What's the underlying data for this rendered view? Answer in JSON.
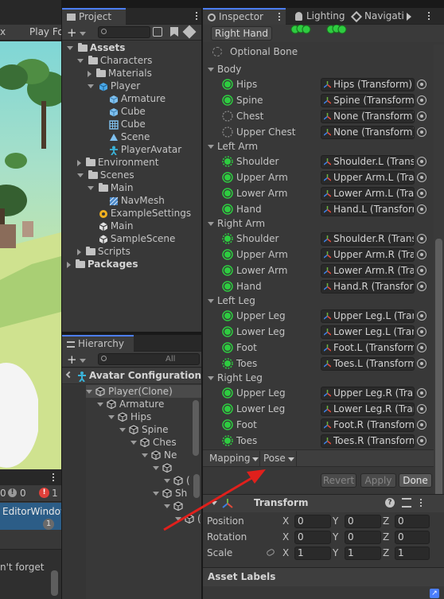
{
  "scene_view": {
    "tabs": [
      "x",
      "Play Fo"
    ],
    "console_counts": [
      "0",
      "0",
      "1"
    ],
    "editor_window_label": "EditorWindow",
    "editor_window_badge": "1",
    "console_message": "n't forget"
  },
  "project": {
    "tab_label": "Project",
    "add_label": "+",
    "tree": [
      {
        "label": "Assets",
        "bold": true,
        "icon": "folder-icon",
        "expanded": true
      },
      {
        "label": "Characters",
        "icon": "folder-icon",
        "expanded": true
      },
      {
        "label": "Materials",
        "icon": "folder-icon",
        "expanded": false
      },
      {
        "label": "Player",
        "icon": "prefab-icon",
        "expanded": true
      },
      {
        "label": "Armature",
        "icon": "mesh-icon"
      },
      {
        "label": "Cube",
        "icon": "mesh-icon"
      },
      {
        "label": "Cube",
        "icon": "grid-icon"
      },
      {
        "label": "Scene",
        "icon": "scene-icon"
      },
      {
        "label": "PlayerAvatar",
        "icon": "avatar-icon"
      },
      {
        "label": "Environment",
        "icon": "folder-icon",
        "expanded": false
      },
      {
        "label": "Scenes",
        "icon": "folder-icon",
        "expanded": true
      },
      {
        "label": "Main",
        "icon": "folder-icon",
        "expanded": true
      },
      {
        "label": "NavMesh",
        "icon": "navmesh-icon"
      },
      {
        "label": "ExampleSettings",
        "icon": "settings-icon"
      },
      {
        "label": "Main",
        "icon": "unity-scene-icon"
      },
      {
        "label": "SampleScene",
        "icon": "unity-scene-icon"
      },
      {
        "label": "Scripts",
        "icon": "folder-icon",
        "expanded": false
      },
      {
        "label": "Packages",
        "bold": true,
        "icon": "folder-icon",
        "expanded": false
      }
    ]
  },
  "hierarchy": {
    "tab_label": "Hierarchy",
    "add_label": "+",
    "search_placeholder": "All",
    "header_label": "Avatar Configuration",
    "tree": [
      {
        "label": "Player(Clone)"
      },
      {
        "label": "Armature"
      },
      {
        "label": "Hips"
      },
      {
        "label": "Spine"
      },
      {
        "label": "Ches"
      },
      {
        "label": "Ne"
      },
      {
        "label": ""
      },
      {
        "label": "("
      },
      {
        "label": "Sh"
      },
      {
        "label": ""
      },
      {
        "label": "("
      }
    ]
  },
  "inspector": {
    "tabs": [
      "Inspector",
      "Lighting",
      "Navigati"
    ],
    "mode_button": "Right Hand",
    "optional_bone_label": "Optional Bone",
    "sections": [
      {
        "title": "Body",
        "bones": [
          {
            "name": "Hips",
            "value": "Hips (Transform)",
            "required": true
          },
          {
            "name": "Spine",
            "value": "Spine (Transform)",
            "required": true
          },
          {
            "name": "Chest",
            "value": "None (Transform)",
            "required": false
          },
          {
            "name": "Upper Chest",
            "value": "None (Transform)",
            "required": false
          }
        ]
      },
      {
        "title": "Left Arm",
        "bones": [
          {
            "name": "Shoulder",
            "value": "Shoulder.L (Transf",
            "required": false,
            "dotted_green": true
          },
          {
            "name": "Upper Arm",
            "value": "Upper Arm.L (Tran",
            "required": true
          },
          {
            "name": "Lower Arm",
            "value": "Lower Arm.L (Tran",
            "required": true
          },
          {
            "name": "Hand",
            "value": "Hand.L (Transform",
            "required": true
          }
        ]
      },
      {
        "title": "Right Arm",
        "bones": [
          {
            "name": "Shoulder",
            "value": "Shoulder.R (Transf",
            "required": false,
            "dotted_green": true
          },
          {
            "name": "Upper Arm",
            "value": "Upper Arm.R (Tran",
            "required": true
          },
          {
            "name": "Lower Arm",
            "value": "Lower Arm.R (Tran",
            "required": true
          },
          {
            "name": "Hand",
            "value": "Hand.R (Transform",
            "required": true
          }
        ]
      },
      {
        "title": "Left Leg",
        "bones": [
          {
            "name": "Upper Leg",
            "value": "Upper Leg.L (Tran",
            "required": true
          },
          {
            "name": "Lower Leg",
            "value": "Lower Leg.L (Tran",
            "required": true
          },
          {
            "name": "Foot",
            "value": "Foot.L (Transform)",
            "required": true
          },
          {
            "name": "Toes",
            "value": "Toes.L (Transform",
            "required": false,
            "dotted_green": true
          }
        ]
      },
      {
        "title": "Right Leg",
        "bones": [
          {
            "name": "Upper Leg",
            "value": "Upper Leg.R (Tran",
            "required": true
          },
          {
            "name": "Lower Leg",
            "value": "Lower Leg.R (Tran",
            "required": true
          },
          {
            "name": "Foot",
            "value": "Foot.R (Transform)",
            "required": true
          },
          {
            "name": "Toes",
            "value": "Toes.R (Transform",
            "required": false,
            "dotted_green": true
          }
        ]
      }
    ],
    "mapping_label": "Mapping",
    "pose_label": "Pose",
    "revert_label": "Revert",
    "apply_label": "Apply",
    "done_label": "Done",
    "transform": {
      "title": "Transform",
      "rows": [
        {
          "label": "Position",
          "x": "0",
          "y": "0",
          "z": "0"
        },
        {
          "label": "Rotation",
          "x": "0",
          "y": "0",
          "z": "0"
        },
        {
          "label": "Scale",
          "x": "1",
          "y": "1",
          "z": "1"
        }
      ]
    },
    "asset_labels": "Asset Labels"
  },
  "colors": {
    "accent": "#4c7eff",
    "bone_green": "#2ecc40",
    "arrow_red": "#e0201c",
    "panel_bg": "#383838",
    "field_bg": "#2a2a2a"
  }
}
